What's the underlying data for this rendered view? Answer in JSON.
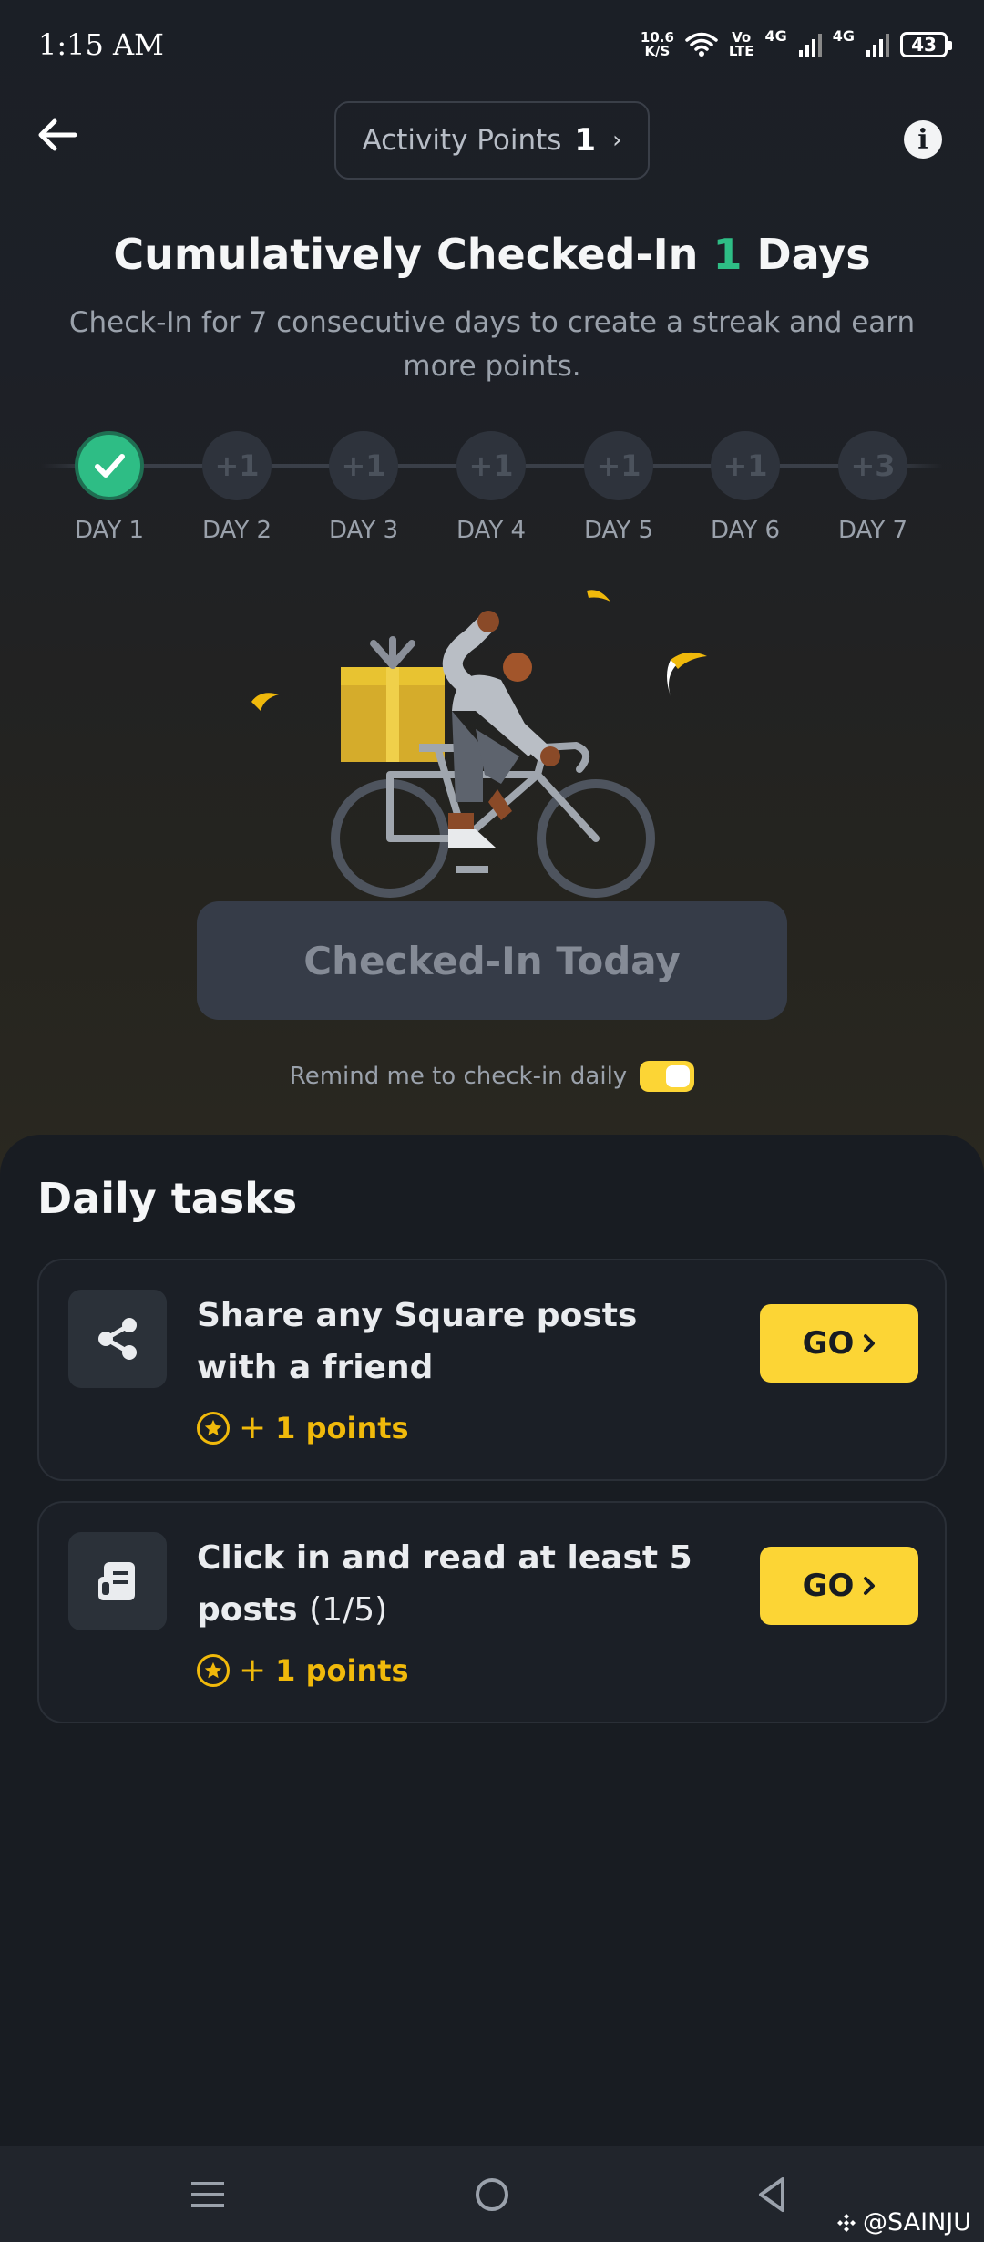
{
  "status_bar": {
    "time": "1:15 AM",
    "net_speed_value": "10.6",
    "net_speed_unit": "K/S",
    "volte_top": "Vo",
    "volte_bottom": "LTE",
    "signal1": "4G",
    "signal2": "4G",
    "battery": "43"
  },
  "header": {
    "points_label": "Activity Points",
    "points_value": "1",
    "back_icon": "arrow-left-icon",
    "info_icon": "info-icon"
  },
  "checkin": {
    "headline_prefix": "Cumulatively Checked-In",
    "headline_days": "1",
    "headline_suffix": "Days",
    "subtext": "Check-In for 7 consecutive days to create a streak and earn more points.",
    "days": [
      {
        "label": "DAY 1",
        "reward": "",
        "done": true
      },
      {
        "label": "DAY 2",
        "reward": "+1",
        "done": false
      },
      {
        "label": "DAY 3",
        "reward": "+1",
        "done": false
      },
      {
        "label": "DAY 4",
        "reward": "+1",
        "done": false
      },
      {
        "label": "DAY 5",
        "reward": "+1",
        "done": false
      },
      {
        "label": "DAY 6",
        "reward": "+1",
        "done": false
      },
      {
        "label": "DAY 7",
        "reward": "+3",
        "done": false
      }
    ],
    "button_label": "Checked-In Today",
    "remind_label": "Remind me to check-in daily",
    "remind_enabled": true
  },
  "tasks": {
    "title": "Daily tasks",
    "items": [
      {
        "title": "Share any Square posts with a friend",
        "progress": "",
        "plus": "+",
        "points": "1 points",
        "button": "GO",
        "icon": "share-icon"
      },
      {
        "title": "Click in and read at least 5 posts",
        "progress": "(1/5)",
        "plus": "+",
        "points": "1 points",
        "button": "GO",
        "icon": "article-icon"
      }
    ]
  },
  "watermark": "@SAINJU",
  "colors": {
    "accent_yellow": "#fcd535",
    "success_green": "#2ebd85",
    "points_gold": "#f0b90b",
    "background": "#181c22"
  }
}
